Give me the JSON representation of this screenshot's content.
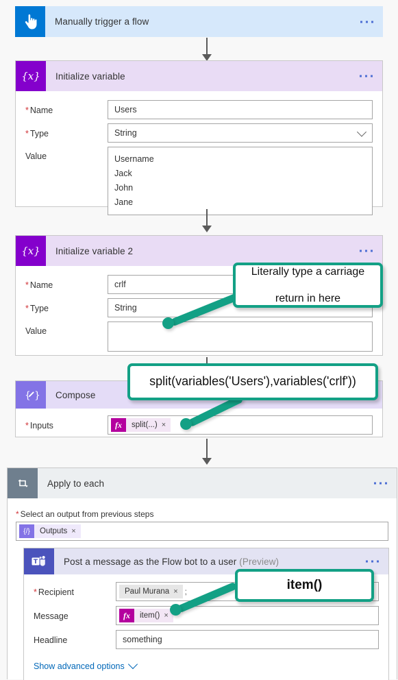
{
  "colors": {
    "trigger_icon": "#0078d4",
    "variable_icon": "#8400cc",
    "compose_icon": "#8373e6",
    "loop_icon": "#6f7f8e",
    "teams_icon": "#4b53bc",
    "callout_green": "#13a085",
    "token_fx": "#b4009e",
    "required_red": "#d13438",
    "link_blue": "#0067b8"
  },
  "steps": {
    "trigger": {
      "title": "Manually trigger a flow",
      "icon": "touch-hand-icon",
      "menu": "more-options"
    },
    "init_variable_1": {
      "title": "Initialize variable",
      "icon": "variable-braces-icon",
      "fields": {
        "name_label": "Name",
        "name_value": "Users",
        "type_label": "Type",
        "type_value": "String",
        "value_label": "Value",
        "value_lines": [
          "Username",
          "Jack",
          "John",
          "Jane"
        ]
      }
    },
    "init_variable_2": {
      "title": "Initialize variable 2",
      "icon": "variable-braces-icon",
      "fields": {
        "name_label": "Name",
        "name_value": "crlf",
        "type_label": "Type",
        "type_value": "String",
        "value_label": "Value",
        "value_value": ""
      }
    },
    "compose": {
      "title": "Compose",
      "icon": "compose-pencil-braces-icon",
      "fields": {
        "inputs_label": "Inputs",
        "inputs_token": "split(...)",
        "inputs_token_badge": "fx",
        "inputs_token_remove": "×"
      }
    },
    "apply_to_each": {
      "title": "Apply to each",
      "icon": "loop-repeat-icon",
      "select_output_label": "Select an output from previous steps",
      "output_token": "Outputs",
      "output_token_badge": "{/}",
      "output_token_remove": "×"
    },
    "post_message": {
      "title": "Post a message as the Flow bot to a user",
      "title_suffix": "(Preview)",
      "icon": "microsoft-teams-icon",
      "fields": {
        "recipient_label": "Recipient",
        "recipient_value": "Paul Murana",
        "recipient_remove": "×",
        "recipient_separator": ";",
        "message_label": "Message",
        "message_token": "item()",
        "message_token_badge": "fx",
        "message_token_remove": "×",
        "headline_label": "Headline",
        "headline_value": "something"
      },
      "advanced_link": "Show advanced options"
    }
  },
  "callouts": {
    "carriage_return": {
      "line1": "Literally type a carriage",
      "line2": "return in here"
    },
    "split_expression": {
      "text": "split(variables('Users'),variables('crlf'))"
    },
    "item_expression": {
      "text": "item()"
    }
  }
}
